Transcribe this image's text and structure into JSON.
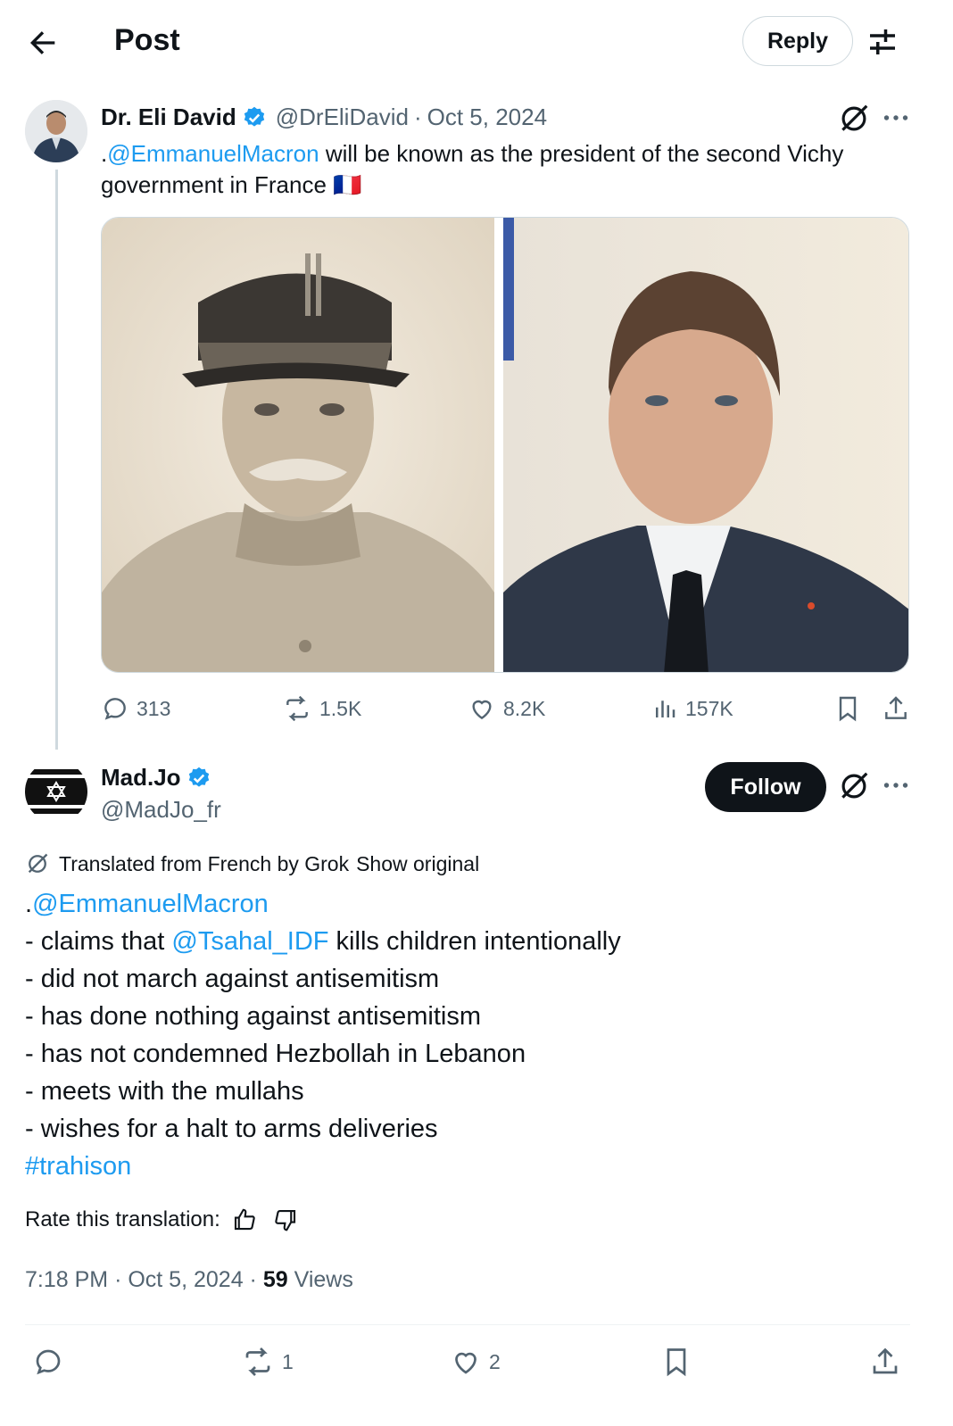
{
  "header": {
    "title": "Post",
    "reply_label": "Reply"
  },
  "tweet1": {
    "name": "Dr. Eli David",
    "handle": "@DrEliDavid",
    "separator": "·",
    "date": "Oct 5, 2024",
    "mention": "@EmmanuelMacron",
    "text_prefix": ".",
    "text_rest": " will be known as the president of the second Vichy government in France",
    "flag": "🇫🇷",
    "stats": {
      "replies": "313",
      "reposts": "1.5K",
      "likes": "8.2K",
      "views": "157K"
    }
  },
  "tweet2": {
    "name": "Mad.Jo",
    "handle": "@MadJo_fr",
    "follow_label": "Follow",
    "translated_label": "Translated from French by Grok",
    "show_original": "Show original",
    "text_prefix": ".",
    "mention1": "@EmmanuelMacron",
    "line1_a": "- claims that ",
    "mention2": "@Tsahal_IDF",
    "line1_b": " kills children intentionally",
    "lines": [
      "- did not march against antisemitism",
      "- has done nothing against antisemitism",
      "- has not condemned Hezbollah in Lebanon",
      "- meets with the mullahs",
      "- wishes for a halt to arms deliveries"
    ],
    "hashtag": "#trahison",
    "rate_label": "Rate this translation:",
    "time": "7:18 PM",
    "date": "Oct 5, 2024",
    "views_count": "59",
    "views_label": "Views",
    "stats": {
      "reposts": "1",
      "likes": "2"
    }
  },
  "colors": {
    "link": "#1d9bf0",
    "verified": "#1d9bf0",
    "text": "#0f1419",
    "muted": "#536471"
  }
}
